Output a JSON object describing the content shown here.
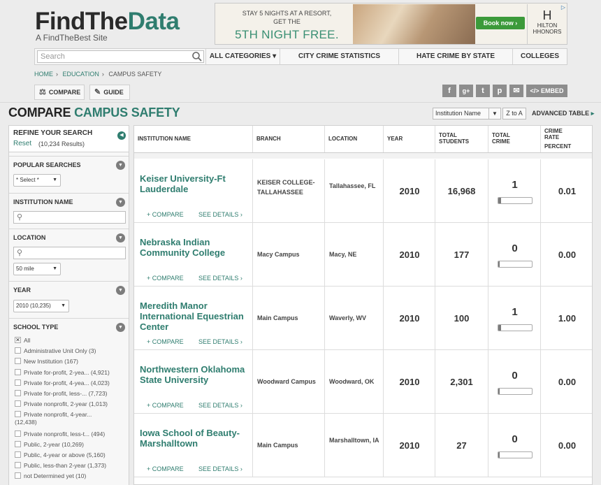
{
  "header": {
    "logo_part1": "FindThe",
    "logo_part2": "Data",
    "tagline": "A FindTheBest Site"
  },
  "ad": {
    "line1": "STAY 5 NIGHTS AT A RESORT,",
    "line1b": "GET THE",
    "line2": "5TH NIGHT FREE.",
    "button": "Book now ›",
    "brand_mark": "H",
    "brand": "HILTON HHONORS"
  },
  "nav": {
    "search_placeholder": "Search",
    "items": [
      "ALL CATEGORIES ▾",
      "CITY CRIME STATISTICS",
      "HATE CRIME BY STATE",
      "COLLEGES"
    ]
  },
  "breadcrumb": [
    "HOME",
    "EDUCATION",
    "CAMPUS SAFETY"
  ],
  "tabs": {
    "compare": "COMPARE",
    "guide": "GUIDE"
  },
  "social": {
    "facebook": "f",
    "gplus": "g+",
    "twitter": "t",
    "pinterest": "p",
    "email": "✉",
    "embed": "</> EMBED"
  },
  "page": {
    "title_main": "COMPARE",
    "title_accent": "CAMPUS SAFETY",
    "sort_by": "Institution Name",
    "sort_order": "Z to A",
    "advanced_table": "ADVANCED TABLE"
  },
  "sidebar": {
    "refine_title": "REFINE YOUR SEARCH",
    "reset": "Reset",
    "result_count": "(10,234 Results)",
    "sections": {
      "popular": {
        "title": "POPULAR SEARCHES",
        "select": "* Select *"
      },
      "institution": {
        "title": "INSTITUTION NAME"
      },
      "location": {
        "title": "LOCATION",
        "radius": "50 mile"
      },
      "year": {
        "title": "YEAR",
        "select": "2010 (10,235)"
      },
      "school_type": {
        "title": "SCHOOL TYPE",
        "options": [
          {
            "label": "All",
            "checked": true
          },
          {
            "label": "Administrative Unit Only (3)",
            "checked": false
          },
          {
            "label": "New Institution (167)",
            "checked": false
          },
          {
            "label": "Private for-profit, 2-yea... (4,921)",
            "checked": false
          },
          {
            "label": "Private for-profit, 4-yea... (4,023)",
            "checked": false
          },
          {
            "label": "Private for-profit, less-... (7,723)",
            "checked": false
          },
          {
            "label": "Private nonprofit, 2-year (1,013)",
            "checked": false
          },
          {
            "label": "Private nonprofit, 4-year...",
            "label2": "(12,438)",
            "checked": false
          },
          {
            "label": "Private nonprofit, less-t... (494)",
            "checked": false
          },
          {
            "label": "Public, 2-year (10,269)",
            "checked": false
          },
          {
            "label": "Public, 4-year or above (5,160)",
            "checked": false
          },
          {
            "label": "Public, less-than 2-year (1,373)",
            "checked": false
          },
          {
            "label": "not Determined yet (10)",
            "checked": false
          }
        ]
      }
    }
  },
  "table": {
    "headers": {
      "name": "INSTITUTION NAME",
      "branch": "BRANCH",
      "location": "LOCATION",
      "year": "YEAR",
      "students1": "TOTAL",
      "students2": "STUDENTS",
      "crime1": "TOTAL",
      "crime2": "CRIME",
      "rate1": "CRIME",
      "rate2": "RATE",
      "rate3": "PERCENT"
    },
    "compare_label": "+ COMPARE",
    "details_label": "SEE DETAILS ›",
    "rows": [
      {
        "name": "Keiser University-Ft Lauderdale",
        "branch": "KEISER COLLEGE-TALLAHASSEE",
        "location": "Tallahassee, FL",
        "year": "2010",
        "students": "16,968",
        "crime": "1",
        "crime_bar": 0.06,
        "rate": "0.01"
      },
      {
        "name": "Nebraska Indian Community College",
        "branch": "Macy Campus",
        "location": "Macy, NE",
        "year": "2010",
        "students": "177",
        "crime": "0",
        "crime_bar": 0.0,
        "rate": "0.00"
      },
      {
        "name": "Meredith Manor International Equestrian Center",
        "branch": "Main Campus",
        "location": "Waverly, WV",
        "year": "2010",
        "students": "100",
        "crime": "1",
        "crime_bar": 0.06,
        "rate": "1.00"
      },
      {
        "name": "Northwestern Oklahoma State University",
        "branch": "Woodward Campus",
        "location": "Woodward, OK",
        "year": "2010",
        "students": "2,301",
        "crime": "0",
        "crime_bar": 0.0,
        "rate": "0.00"
      },
      {
        "name": "Iowa School of Beauty-Marshalltown",
        "branch": "Main Campus",
        "location": "Marshalltown, IA",
        "year": "2010",
        "students": "27",
        "crime": "0",
        "crime_bar": 0.0,
        "rate": "0.00"
      }
    ]
  }
}
